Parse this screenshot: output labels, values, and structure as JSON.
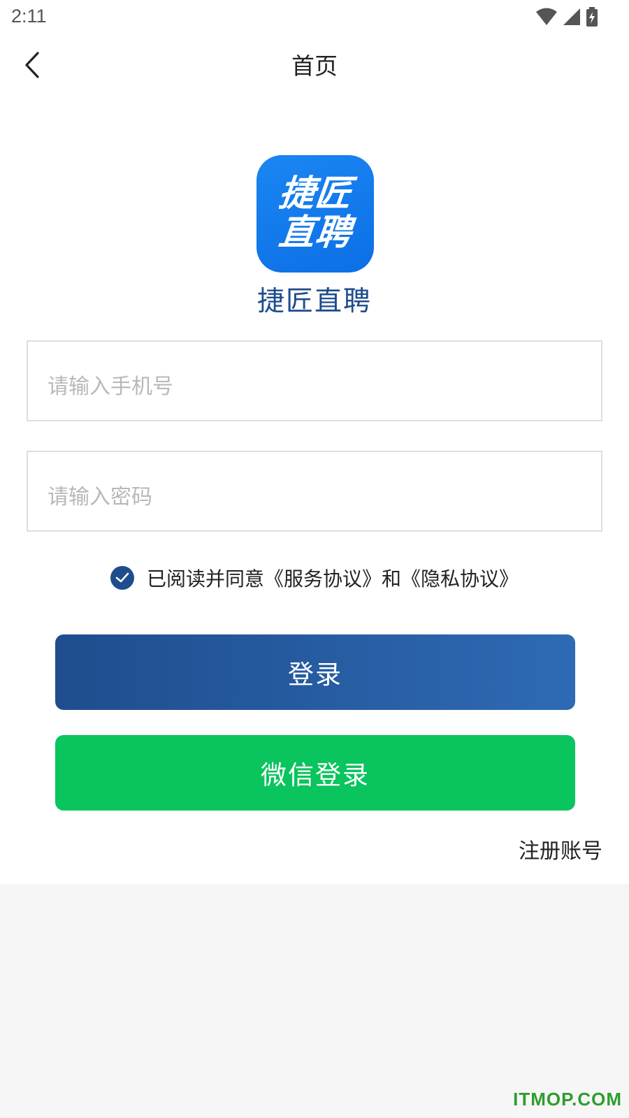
{
  "status_bar": {
    "time": "2:11",
    "icons": [
      "wifi-icon",
      "cellular-signal-icon",
      "battery-charging-icon"
    ]
  },
  "header": {
    "title": "首页",
    "back_icon": "chevron-left-icon"
  },
  "logo": {
    "line1": "捷匠",
    "line2": "直聘",
    "color": "#1182ee"
  },
  "app_name": "捷匠直聘",
  "form": {
    "phone_placeholder": "请输入手机号",
    "phone_value": "",
    "password_placeholder": "请输入密码",
    "password_value": ""
  },
  "agreement": {
    "checked": true,
    "text": "已阅读并同意《服务协议》和《隐私协议》"
  },
  "buttons": {
    "login": "登录",
    "wechat_login": "微信登录",
    "register": "注册账号"
  },
  "watermark": "ITMOP.COM",
  "colors": {
    "accent": "#1f4c8c",
    "wechat_green": "#0ac45e",
    "app_name": "#1e4c8b"
  }
}
